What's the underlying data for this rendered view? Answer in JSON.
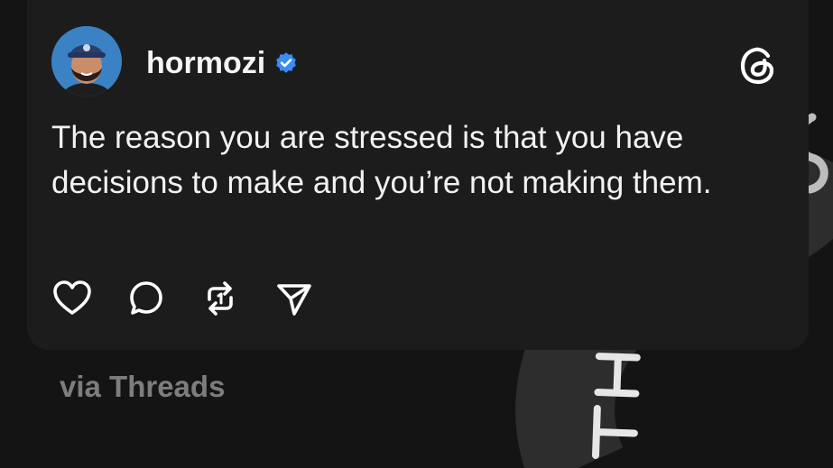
{
  "post": {
    "username": "hormozi",
    "text": "The reason you are stressed is that you have decisions to make and you’re not making them.",
    "verified": true
  },
  "icons": {
    "avatar": "profile-photo",
    "verified": "verified-badge-icon",
    "brand": "threads-logo-icon",
    "actions": [
      "heart-icon",
      "comment-icon",
      "repost-icon",
      "share-icon"
    ]
  },
  "footer": {
    "caption": "via Threads"
  },
  "colors": {
    "background": "#141414",
    "card": "#1c1c1d",
    "text": "#f2f2f2",
    "caption": "#7d7d7d",
    "verified": "#3b8cf5"
  }
}
